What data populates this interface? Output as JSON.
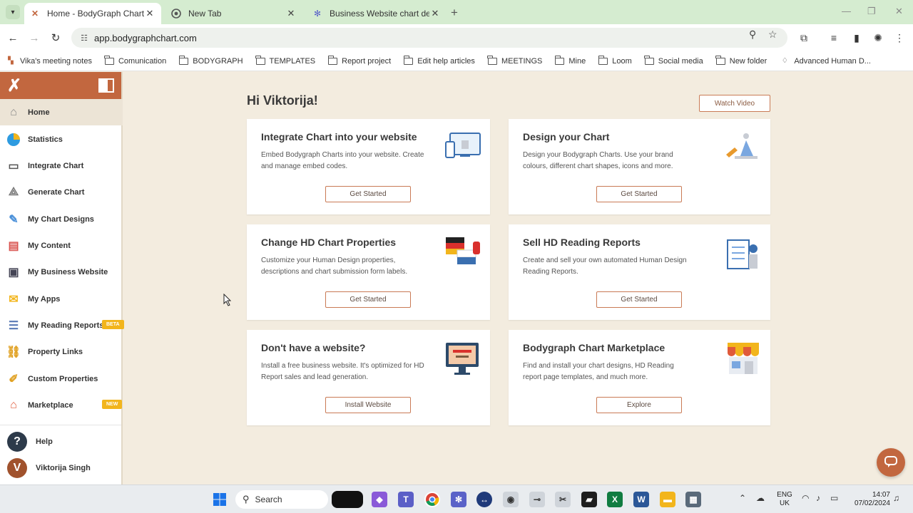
{
  "browser": {
    "tabs": [
      {
        "title": "Home - BodyGraph Chart",
        "active": true
      },
      {
        "title": "New Tab",
        "active": false
      },
      {
        "title": "Business Website chart design",
        "active": false
      }
    ],
    "url": "app.bodygraphchart.com",
    "bookmarks": [
      {
        "label": "Vika's meeting notes",
        "icon": "note-icon"
      },
      {
        "label": "Comunication",
        "icon": "folder-icon"
      },
      {
        "label": "BODYGRAPH",
        "icon": "folder-icon"
      },
      {
        "label": "TEMPLATES",
        "icon": "folder-icon"
      },
      {
        "label": "Report project",
        "icon": "folder-icon"
      },
      {
        "label": "Edit help articles",
        "icon": "folder-icon"
      },
      {
        "label": "MEETINGS",
        "icon": "folder-icon"
      },
      {
        "label": "Mine",
        "icon": "folder-icon"
      },
      {
        "label": "Loom",
        "icon": "folder-icon"
      },
      {
        "label": "Social media",
        "icon": "folder-icon"
      },
      {
        "label": "New folder",
        "icon": "folder-icon"
      },
      {
        "label": "Advanced Human D...",
        "icon": "bookmark-icon"
      }
    ]
  },
  "sidebar": {
    "items": [
      {
        "label": "Home",
        "icon": "home-icon",
        "active": true
      },
      {
        "label": "Statistics",
        "icon": "pie-chart-icon"
      },
      {
        "label": "Integrate Chart",
        "icon": "embed-icon"
      },
      {
        "label": "Generate Chart",
        "icon": "bodygraph-icon"
      },
      {
        "label": "My Chart Designs",
        "icon": "design-icon"
      },
      {
        "label": "My Content",
        "icon": "content-icon"
      },
      {
        "label": "My Business Website",
        "icon": "website-icon"
      },
      {
        "label": "My Apps",
        "icon": "apps-icon"
      },
      {
        "label": "My Reading Reports",
        "icon": "report-icon",
        "badge": "BETA"
      },
      {
        "label": "Property Links",
        "icon": "link-icon"
      },
      {
        "label": "Custom Properties",
        "icon": "custom-properties-icon"
      },
      {
        "label": "Marketplace",
        "icon": "marketplace-icon",
        "badge": "NEW"
      }
    ],
    "help_label": "Help",
    "user_initial": "V",
    "user_name": "Viktorija Singh"
  },
  "main": {
    "greeting": "Hi Viktorija!",
    "watch_video": "Watch Video",
    "cards": [
      {
        "title": "Integrate Chart into your website",
        "desc": "Embed Bodygraph Charts into your website. Create and manage embed codes.",
        "button": "Get Started"
      },
      {
        "title": "Design your Chart",
        "desc": "Design your Bodygraph Charts. Use your brand colours, different chart shapes, icons and more.",
        "button": "Get Started"
      },
      {
        "title": "Change HD Chart Properties",
        "desc": "Customize your Human Design properties, descriptions and chart submission form labels.",
        "button": "Get Started"
      },
      {
        "title": "Sell HD Reading Reports",
        "desc": "Create and sell your own automated Human Design Reading Reports.",
        "button": "Get Started"
      },
      {
        "title": "Don't have a website?",
        "desc": "Install a free business website. It's optimized for HD Report sales and lead generation.",
        "button": "Install Website"
      },
      {
        "title": "Bodygraph Chart Marketplace",
        "desc": "Find and install your chart designs, HD Reading report page templates, and much more.",
        "button": "Explore"
      }
    ]
  },
  "taskbar": {
    "search_label": "Search",
    "lang_top": "ENG",
    "lang_bottom": "UK",
    "time": "14:07",
    "date": "07/02/2024"
  },
  "colors": {
    "brand": "#c2673f",
    "background": "#f3ecdf",
    "badge": "#f2b51c"
  }
}
